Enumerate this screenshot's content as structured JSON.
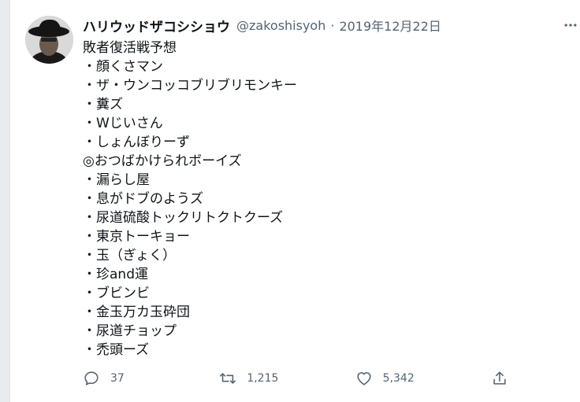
{
  "tweet": {
    "author_name": "ハリウッドザコシショウ",
    "author_handle": "@zakoshisyoh",
    "separator": "·",
    "date": "2019年12月22日",
    "lines": [
      "敗者復活戦予想",
      "・顔くさマン",
      "・ザ・ウンコッコブリブリモンキー",
      "・糞ズ",
      "・Wじいさん",
      "・しょんぼりーず",
      "◎おつばかけられボーイズ",
      "・漏らし屋",
      "・息がドブのようズ",
      "・尿道硫酸トックリトクトクーズ",
      "・東京トーキョー",
      "・玉（ぎょく）",
      "・珍and運",
      "・ブビンビ",
      "・金玉万カ玉砕団",
      "・尿道チョップ",
      "・禿頭ーズ"
    ],
    "replies": "37",
    "retweets": "1,215",
    "likes": "5,342"
  },
  "icons": [
    "more-icon",
    "reply-icon",
    "retweet-icon",
    "like-icon",
    "share-icon"
  ],
  "colors": {
    "text": "#0f1419",
    "secondary": "#536471",
    "background": "#ffffff"
  }
}
